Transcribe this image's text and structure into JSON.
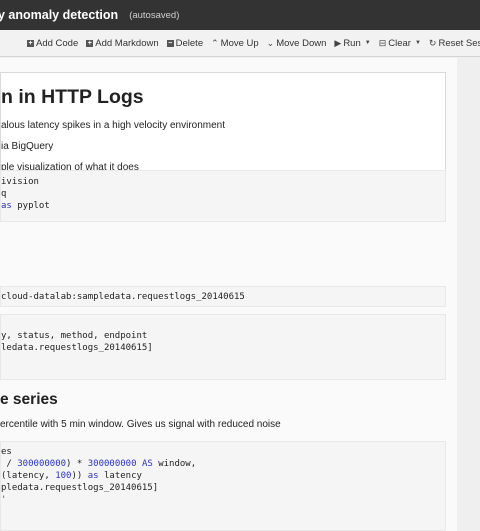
{
  "window": {
    "title": "y anomaly detection",
    "autosave": "(autosaved)"
  },
  "toolbar": {
    "add_code": "Add Code",
    "add_markdown": "Add Markdown",
    "delete": "Delete",
    "move_up": "Move Up",
    "move_down": "Move Down",
    "run": "Run",
    "clear": "Clear",
    "reset_session": "Reset Session"
  },
  "intro": {
    "heading": "n in HTTP Logs",
    "line1": "alous latency spikes in a high velocity environment",
    "line2": "ia BigQuery",
    "line3": "ple visualization of what it does"
  },
  "cell1": {
    "l1a": "ivision",
    "l2a": "q",
    "l3b": " pyplot",
    "kw_as": "as"
  },
  "cell2": {
    "l1": "cloud-datalab:sampledata.requestlogs_20140615"
  },
  "cell3": {
    "l1": "y, status, method, endpoint",
    "l2": "ledata.requestlogs_20140615]"
  },
  "section2": {
    "heading": "e series",
    "desc": "ercentile with 5 min window. Gives us signal with reduced noise"
  },
  "cell4": {
    "l1": "es",
    "l2a": " / ",
    "l2n1": "300000000",
    "l2b": ") * ",
    "l2n2": "300000000",
    "l2c": " ",
    "l2kw": "AS",
    "l2d": " window,",
    "l3a": "(latency, ",
    "l3n": "100",
    "l3b": ")) ",
    "l3kw": "as",
    "l3c": " latency",
    "l4": "pledata.requestlogs_20140615]",
    "l5": "'"
  }
}
